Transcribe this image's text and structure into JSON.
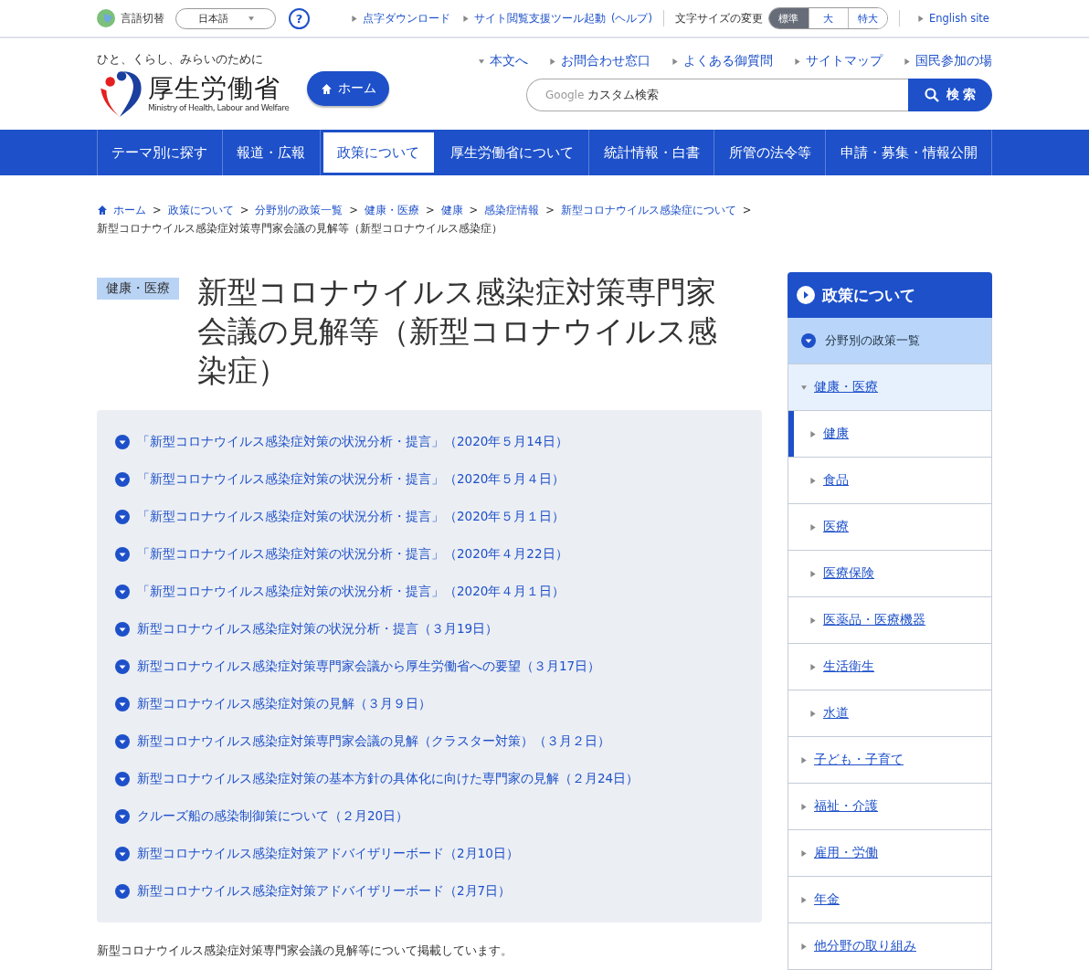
{
  "utility_bar": {
    "language_label": "言語切替",
    "language_select": "日本語",
    "help": "?",
    "links": [
      "点字ダウンロード",
      "サイト閲覧支援ツール起動"
    ],
    "help_link": "(ヘルプ)",
    "font_size_label": "文字サイズの変更",
    "font_sizes": [
      {
        "label": "標準",
        "selected": true
      },
      {
        "label": "大",
        "selected": false
      },
      {
        "label": "特大",
        "selected": false
      }
    ],
    "english_link": "English site"
  },
  "header": {
    "tagline": "ひと、くらし、みらいのために",
    "logo_name": "厚生労働省",
    "logo_sub": "Ministry of Health, Labour and Welfare",
    "home_button": "ホーム",
    "links": [
      {
        "label": "本文へ",
        "kind": "down"
      },
      {
        "label": "お問合わせ窓口",
        "kind": "right"
      },
      {
        "label": "よくある御質問",
        "kind": "right"
      },
      {
        "label": "サイトマップ",
        "kind": "right"
      },
      {
        "label": "国民参加の場",
        "kind": "right"
      }
    ],
    "search": {
      "brand": "Google",
      "placeholder": "カスタム検索",
      "button": "検 索"
    }
  },
  "nav": [
    {
      "label": "テーマ別に探す",
      "selected": false
    },
    {
      "label": "報道・広報",
      "selected": false
    },
    {
      "label": "政策について",
      "selected": true
    },
    {
      "label": "厚生労働省について",
      "selected": false
    },
    {
      "label": "統計情報・白書",
      "selected": false
    },
    {
      "label": "所管の法令等",
      "selected": false
    },
    {
      "label": "申請・募集・情報公開",
      "selected": false
    }
  ],
  "breadcrumb": {
    "separator": ">",
    "links": [
      "ホーム",
      "政策について",
      "分野別の政策一覧",
      "健康・医療",
      "健康",
      "感染症情報",
      "新型コロナウイルス感染症について"
    ],
    "current": "新型コロナウイルス感染症対策専門家会議の見解等（新型コロナウイルス感染症）"
  },
  "page": {
    "category": "健康・医療",
    "title": "新型コロナウイルス感染症対策専門家会議の見解等（新型コロナウイルス感染症）",
    "links": [
      "「新型コロナウイルス感染症対策の状況分析・提言」（2020年５月14日）",
      "「新型コロナウイルス感染症対策の状況分析・提言」（2020年５月４日）",
      "「新型コロナウイルス感染症対策の状況分析・提言」（2020年５月１日）",
      "「新型コロナウイルス感染症対策の状況分析・提言」（2020年４月22日）",
      "「新型コロナウイルス感染症対策の状況分析・提言」（2020年４月１日）",
      "新型コロナウイルス感染症対策の状況分析・提言（３月19日）",
      "新型コロナウイルス感染症対策専門家会議から厚生労働省への要望（３月17日）",
      "新型コロナウイルス感染症対策の見解（３月９日）",
      "新型コロナウイルス感染症対策専門家会議の見解（クラスター対策）（３月２日）",
      "新型コロナウイルス感染症対策の基本方針の具体化に向けた専門家の見解（２月24日）",
      "クルーズ船の感染制御策について（２月20日）",
      "新型コロナウイルス感染症対策アドバイザリーボード（2月10日）",
      "新型コロナウイルス感染症対策アドバイザリーボード（2月7日）"
    ],
    "note": "新型コロナウイルス感染症対策専門家会議の見解等について掲載しています。"
  },
  "sidebar": {
    "title": "政策について",
    "section": "分野別の政策一覧",
    "items": [
      {
        "label": "健康・医療",
        "expanded": true,
        "children": [
          {
            "label": "健康",
            "selected": true
          },
          {
            "label": "食品",
            "selected": false
          },
          {
            "label": "医療",
            "selected": false
          },
          {
            "label": "医療保険",
            "selected": false
          },
          {
            "label": "医薬品・医療機器",
            "selected": false
          },
          {
            "label": "生活衛生",
            "selected": false
          },
          {
            "label": "水道",
            "selected": false
          }
        ]
      },
      {
        "label": "子ども・子育て",
        "expanded": false
      },
      {
        "label": "福祉・介護",
        "expanded": false
      },
      {
        "label": "雇用・労働",
        "expanded": false
      },
      {
        "label": "年金",
        "expanded": false
      },
      {
        "label": "他分野の取り組み",
        "expanded": false
      }
    ]
  }
}
